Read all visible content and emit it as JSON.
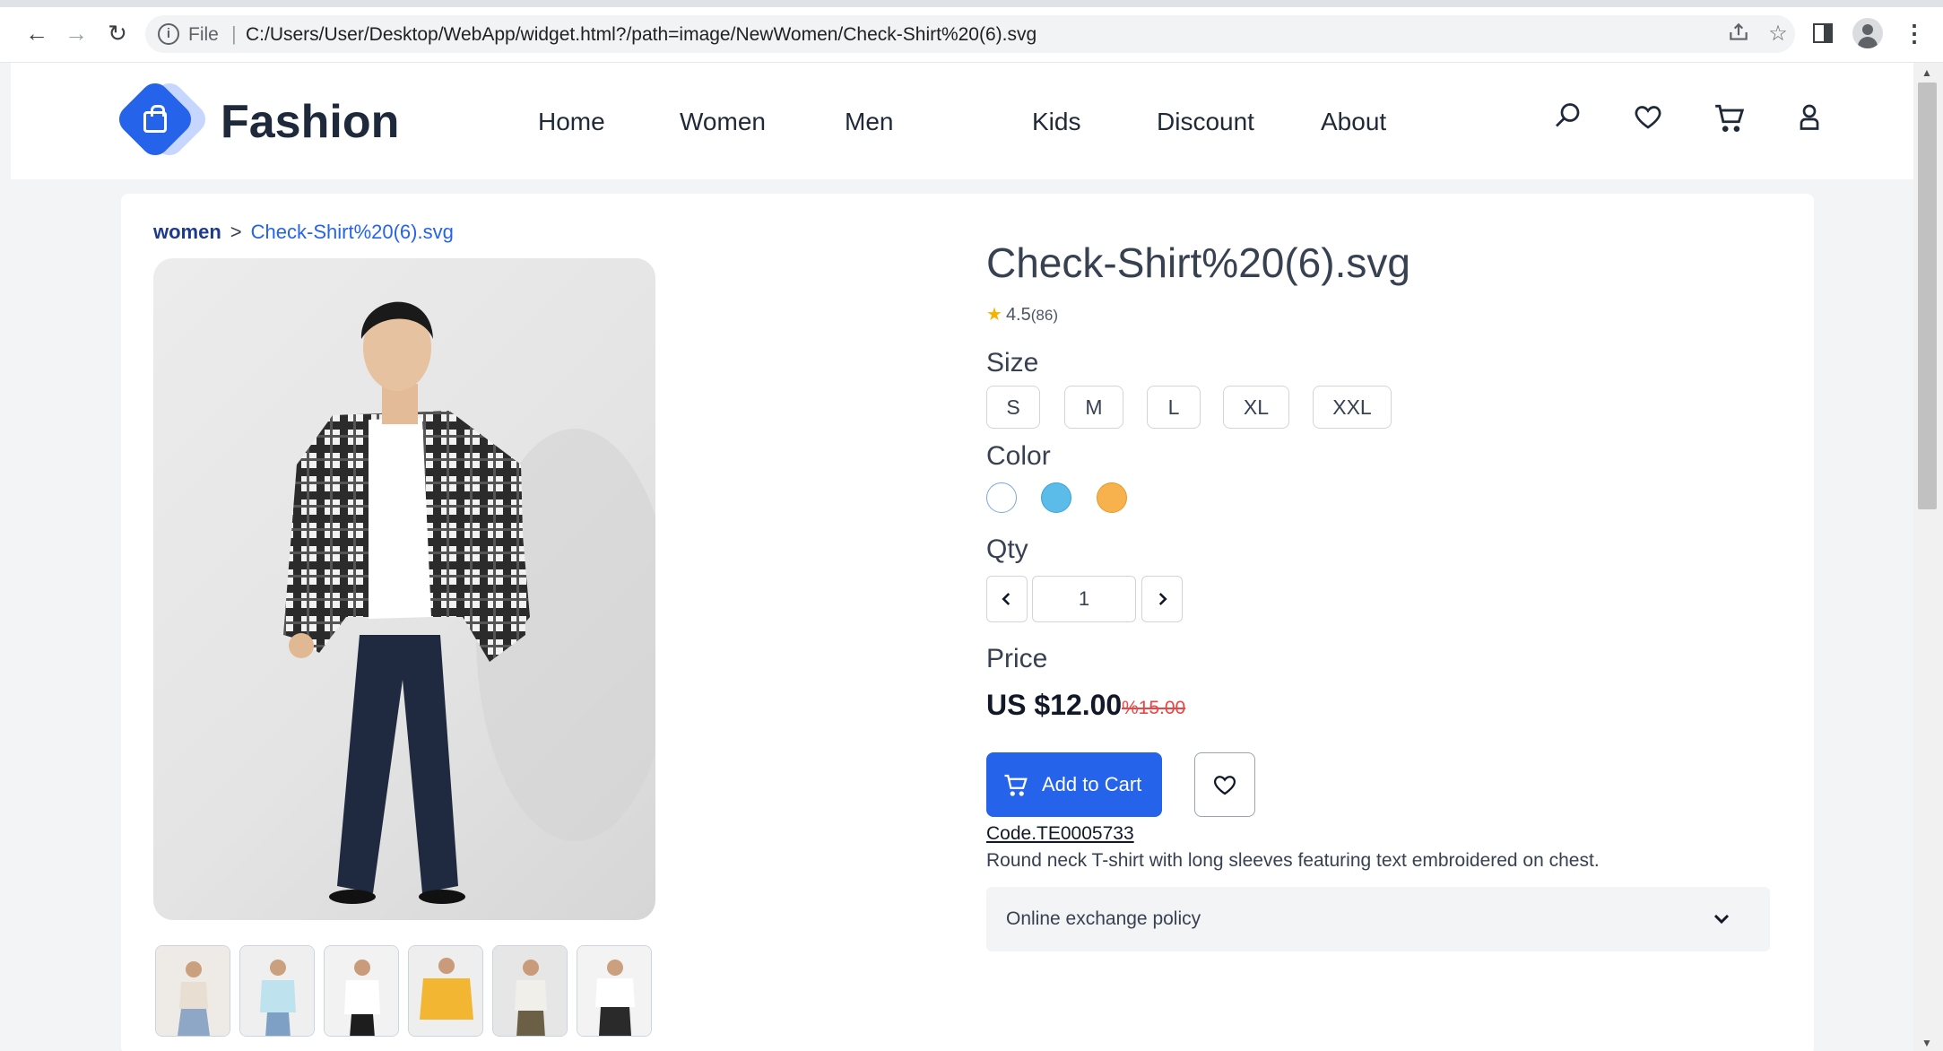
{
  "browser": {
    "file_label": "File",
    "url": "C:/Users/User/Desktop/WebApp/widget.html?/path=image/NewWomen/Check-Shirt%20(6).svg"
  },
  "header": {
    "brand": "Fashion",
    "nav": [
      "Home",
      "Women",
      "Men",
      "Kids",
      "Discount",
      "About"
    ]
  },
  "breadcrumb": {
    "home": "women",
    "separator": ">",
    "current": "Check-Shirt%20(6).svg"
  },
  "product": {
    "title": "Check-Shirt%20(6).svg",
    "rating": "4.5",
    "rating_count": "(86)",
    "rating_value": 4.5,
    "size_label": "Size",
    "sizes": [
      "S",
      "M",
      "L",
      "XL",
      "XXL"
    ],
    "color_label": "Color",
    "colors": [
      "#ffffff",
      "#5bbce9",
      "#f7b24d"
    ],
    "qty_label": "Qty",
    "qty": "1",
    "price_label": "Price",
    "price": "US $12.00",
    "old_price": "%15.00",
    "add_to_cart": "Add to Cart",
    "code": "Code.TE0005733",
    "description": "Round neck T-shirt with long sleeves featuring text embroidered on chest.",
    "policy": "Online exchange policy"
  },
  "icons": {
    "header": [
      "search-icon",
      "heart-icon",
      "cart-icon",
      "user-icon"
    ],
    "accent": "#2563eb"
  }
}
